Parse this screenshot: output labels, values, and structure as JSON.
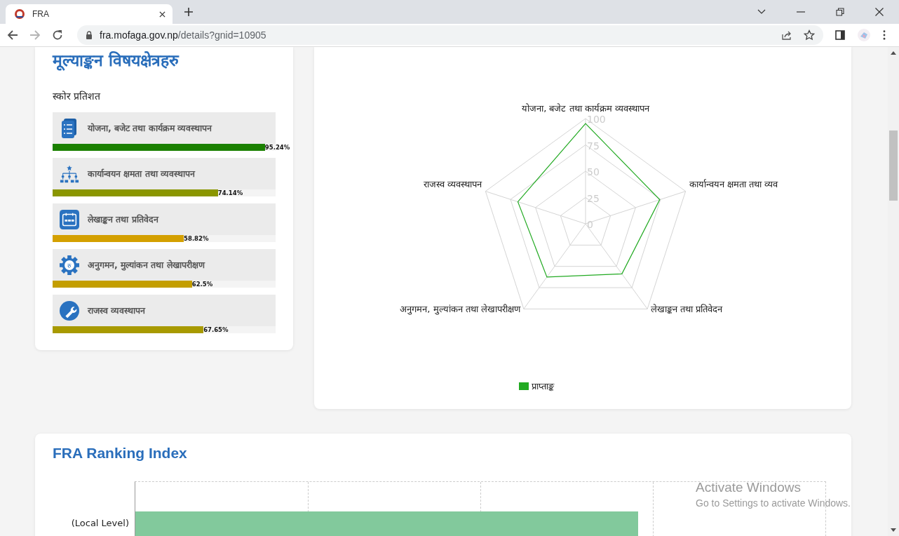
{
  "browser": {
    "tab": {
      "title": "FRA"
    },
    "url": {
      "host": "fra.mofaga.gov.np",
      "path": "/details?gnid=10905"
    },
    "forward_disabled": true
  },
  "areas_card": {
    "title": "मूल्याङ्कन विषयक्षेत्रहरु",
    "subtitle": "स्कोर प्रतिशत",
    "items": [
      {
        "kind": "checklist",
        "label": "योजना, बजेट तथा कार्यक्रम व्यवस्थापन",
        "level": 0.9524,
        "reading": "95.24%",
        "color": "#1a8000"
      },
      {
        "kind": "hierarchy",
        "label": "कार्यान्वयन क्षमता तथा व्यवस्थापन",
        "level": 0.7414,
        "reading": "74.14%",
        "color": "#8a9600"
      },
      {
        "kind": "calendar",
        "label": "लेखाङ्कन तथा प्रतिवेदन",
        "level": 0.5882,
        "reading": "58.82%",
        "color": "#d4a000"
      },
      {
        "kind": "gear",
        "glyph": "रु",
        "label": "अनुगमन, मुल्यांकन तथा लेखापरीक्षण",
        "level": 0.625,
        "reading": "62.5%",
        "color": "#c49e00"
      },
      {
        "kind": "wrench",
        "label": "राजस्व व्यवस्थापन",
        "level": 0.6765,
        "reading": "67.65%",
        "color": "#a89a00"
      }
    ]
  },
  "radar": {
    "chart_data": {
      "type": "radar",
      "categories": [
        "योजना, बजेट तथा कार्यक्रम व्यवस्थापन",
        "कार्यान्वयन क्षमता तथा व्यव",
        "लेखाङ्कन तथा प्रतिवेदन",
        "अनुगमन, मुल्यांकन तथा लेखापरीक्षण",
        "राजस्व व्यवस्थापन"
      ],
      "ylim": [
        0,
        100
      ],
      "yticks": [
        0,
        25,
        50,
        75,
        100
      ],
      "series": [
        {
          "name": "प्राप्ताङ्क",
          "color": "#22aa22",
          "values": [
            95.24,
            74.14,
            58.82,
            62.5,
            67.65
          ]
        }
      ]
    }
  },
  "ranking": {
    "title": "FRA Ranking Index",
    "chart": {
      "category": "(Local Level)"
    }
  },
  "os_watermark": {
    "title": "Activate Windows",
    "subtitle": "Go to Settings to activate Windows."
  }
}
